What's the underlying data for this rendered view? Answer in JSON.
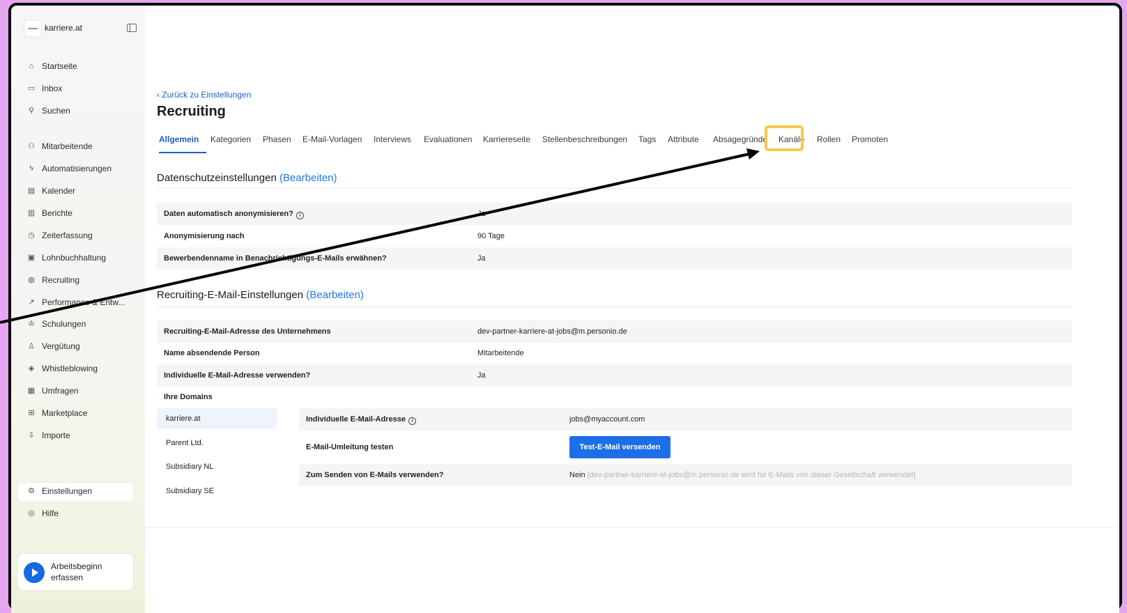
{
  "sidebar": {
    "brand": "karriere.at",
    "items": [
      {
        "label": "Startseite",
        "icon": "home-icon",
        "glyph": "⌂"
      },
      {
        "label": "Inbox",
        "icon": "inbox-icon",
        "glyph": "▭"
      },
      {
        "label": "Suchen",
        "icon": "search-icon",
        "glyph": "⚲"
      },
      {
        "label": "Mitarbeitende",
        "icon": "people-icon",
        "glyph": "⚇"
      },
      {
        "label": "Automatisierungen",
        "icon": "bolt-icon",
        "glyph": "ϟ"
      },
      {
        "label": "Kalender",
        "icon": "calendar-icon",
        "glyph": "▤"
      },
      {
        "label": "Berichte",
        "icon": "report-icon",
        "glyph": "▥"
      },
      {
        "label": "Zeiterfassung",
        "icon": "clock-icon",
        "glyph": "◷"
      },
      {
        "label": "Lohnbuchhaltung",
        "icon": "payroll-icon",
        "glyph": "▣"
      },
      {
        "label": "Recruiting",
        "icon": "globe-icon",
        "glyph": "◍"
      },
      {
        "label": "Performance & Entw...",
        "icon": "performance-icon",
        "glyph": "↗"
      },
      {
        "label": "Schulungen",
        "icon": "graduation-icon",
        "glyph": "♔"
      },
      {
        "label": "Vergütung",
        "icon": "compensation-icon",
        "glyph": "♙"
      },
      {
        "label": "Whistleblowing",
        "icon": "shield-icon",
        "glyph": "◈"
      },
      {
        "label": "Umfragen",
        "icon": "survey-icon",
        "glyph": "▦"
      },
      {
        "label": "Marketplace",
        "icon": "grid-icon",
        "glyph": "⊞"
      },
      {
        "label": "Importe",
        "icon": "import-icon",
        "glyph": "⇩"
      }
    ],
    "settings": "Einstellungen",
    "help": "Hilfe",
    "start_work": "Arbeitsbeginn erfassen"
  },
  "header": {
    "back": "‹ Zurück zu Einstellungen",
    "title": "Recruiting"
  },
  "tabs": [
    "Allgemein",
    "Kategorien",
    "Phasen",
    "E-Mail-Vorlagen",
    "Interviews",
    "Evaluationen",
    "Karriereseite",
    "Stellenbeschreibungen",
    "Tags",
    "Attribute",
    "Absagegründe",
    "Kanäle",
    "Rollen",
    "Promoten"
  ],
  "privacy": {
    "title": "Datenschutzeinstellungen",
    "edit": "(Bearbeiten)",
    "rows": [
      {
        "key": "Daten automatisch anonymisieren?",
        "value": "Ja"
      },
      {
        "key": "Anonymisierung nach",
        "value": "90 Tage"
      },
      {
        "key": "Bewerbendenname in Benachrichtigungs-E-Mails erwähnen?",
        "value": "Ja"
      }
    ]
  },
  "email": {
    "title": "Recruiting-E-Mail-Einstellungen",
    "edit": "(Bearbeiten)",
    "rows": [
      {
        "key": "Recruiting-E-Mail-Adresse des Unternehmens",
        "value": "dev-partner-karriere-at-jobs@m.personio.de"
      },
      {
        "key": "Name absendende Person",
        "value": "Mitarbeitende"
      },
      {
        "key": "Individuelle E-Mail-Adresse verwenden?",
        "value": "Ja"
      }
    ]
  },
  "domains": {
    "label": "Ihre Domains",
    "list": [
      "karriere.at",
      "Parent Ltd.",
      "Subsidiary NL",
      "Subsidiary SE"
    ],
    "detail": {
      "address_label": "Individuelle E-Mail-Adresse",
      "address_value": "jobs@myaccount.com",
      "test_label": "E-Mail-Umleitung testen",
      "test_button": "Test-E-Mail versenden",
      "use_label": "Zum Senden von E-Mails verwenden?",
      "use_value": "Nein",
      "use_note": "[dev-partner-karriere-at-jobs@m.personio.de wird für E-Mails von dieser Gesellschaft verwendet]"
    }
  },
  "colors": {
    "accent": "#1a5fcc",
    "highlight": "#f7c948",
    "button": "#1d6fe6"
  }
}
